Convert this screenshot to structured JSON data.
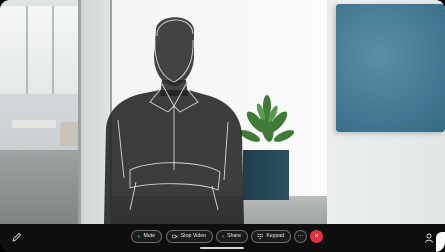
{
  "controls": {
    "mute_label": "Mute",
    "video_label": "Stop Video",
    "share_label": "Share",
    "keypad_label": "Keypad",
    "more_label": "···",
    "end_label": "×"
  },
  "colors": {
    "mute_icon": "#2bb673",
    "end_call": "#e0303e",
    "bar_bg": "#0e0e0e"
  },
  "icons": {
    "edit": "pencil-icon",
    "mute": "microphone-icon",
    "video": "camera-icon",
    "share": "share-screen-icon",
    "keypad": "keypad-icon",
    "people": "participants-icon"
  }
}
